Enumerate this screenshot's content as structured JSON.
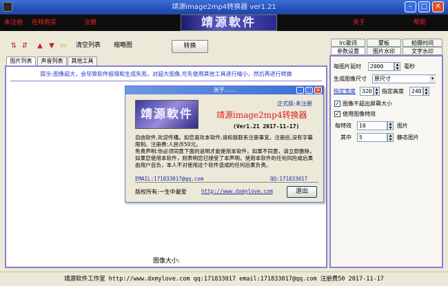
{
  "window": {
    "title": "靖源image2mp4转换器 ver1.21"
  },
  "banner": {
    "unregistered": "未注册",
    "buy_online": "在线购买",
    "register": "注册",
    "logo_text": "靖源軟件",
    "about": "关于",
    "help": "帮助"
  },
  "toolbar": {
    "clear_list": "清空列表",
    "thumbnails": "缩略图",
    "convert": "转换"
  },
  "left_tabs": [
    "图片列表",
    "声音列表",
    "其他工具"
  ],
  "left_panel": {
    "hint": "提示:图像超大，会导致软件报错和生成失败。对超大图像,可先使用其他工具进行缩小，然后再进行转换",
    "image_size_label": "图像大小:"
  },
  "right_tabs_row1": [
    "lrc歌词",
    "蒙板",
    "拍摄时间"
  ],
  "right_tabs_row2": [
    "参数设置",
    "图片水印",
    "文字水印"
  ],
  "settings": {
    "delay_label": "每图片延时",
    "delay_value": "2000",
    "delay_unit": "毫秒",
    "size_label": "生成图像尺寸",
    "size_value": "原尺寸",
    "width_label": "指定宽度",
    "width_value": "320",
    "height_label": "指定高度",
    "height_value": "240",
    "no_exceed_label": "图像不超出屏幕大小",
    "use_effects_label": "使用图像特效",
    "per_effect_label": "每特效",
    "per_effect_value": "10",
    "per_effect_unit": "图片",
    "among_label": "其中",
    "among_value": "5",
    "among_unit": "静态图片"
  },
  "dialog": {
    "title": "关于......",
    "version_status": "正式版:未注册",
    "logo_text": "靖源軟件",
    "app_name": "靖源image2mp4转换器",
    "version": "(Ver1.21 2017-11-17)",
    "body": "自由软件,欢迎传播。如您喜欢本软件,请和我联系注册事宜。注册后,没有字幕限制。注册费:人民币50元。\n免责声明:你必须同意下面的说明才能使用本软件，如果不同意，请立即删除，如果您使用本软件，则表明您已接受了本声明。使用本软件的任何风险或后果由用户自负，本人不对使用这个软件造成的任何后果负责。",
    "email": "EMAIL:171833017@qq.com",
    "qq": "QQ:171833017",
    "copyright": "版权所有:一生中最爱",
    "website": "http://www.dxmylove.com",
    "ok": "退出"
  },
  "status": {
    "text": "靖源软件工作室 http://www.dxmylove.com qq:171833017 email:171833017@qq.com 注册费50 2017-11-17"
  }
}
